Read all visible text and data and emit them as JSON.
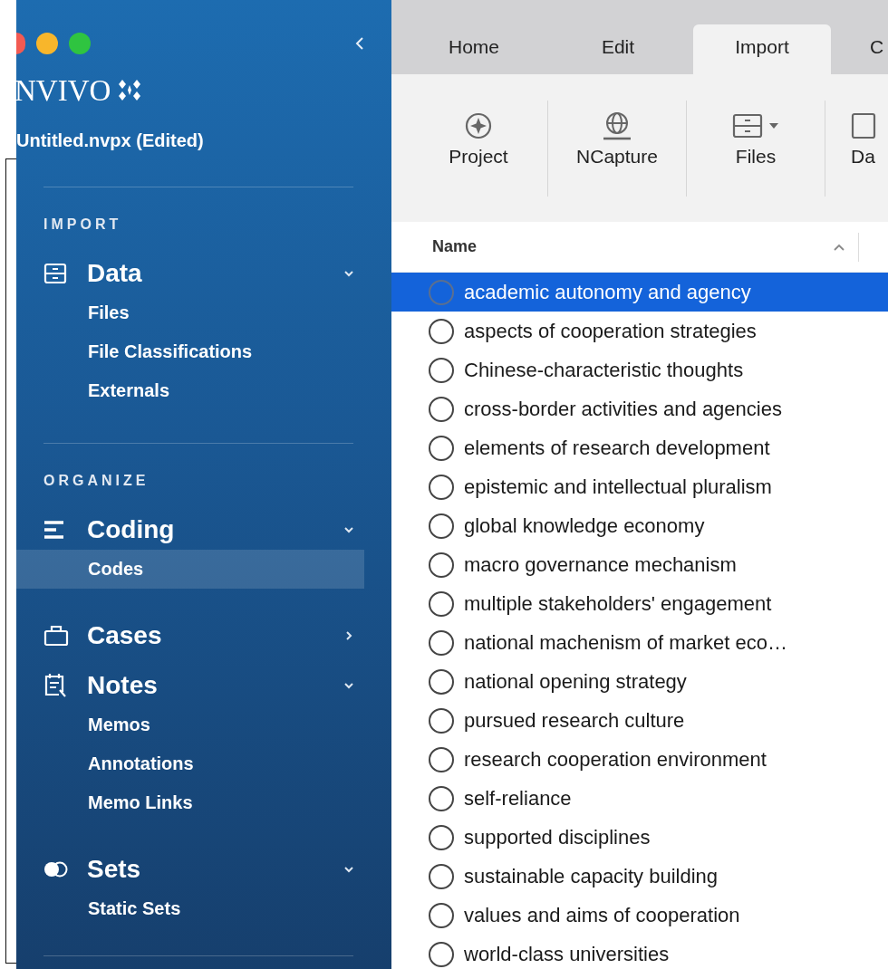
{
  "sidebar": {
    "logo": "NVIVO",
    "file_name": "Untitled.nvpx (Edited)",
    "sections": [
      {
        "heading": "IMPORT",
        "groups": [
          {
            "kind": "data",
            "label": "Data",
            "expanded": true,
            "items": [
              {
                "label": "Files",
                "selected": false
              },
              {
                "label": "File Classifications",
                "selected": false
              },
              {
                "label": "Externals",
                "selected": false
              }
            ]
          }
        ]
      },
      {
        "heading": "ORGANIZE",
        "groups": [
          {
            "kind": "coding",
            "label": "Coding",
            "expanded": true,
            "items": [
              {
                "label": "Codes",
                "selected": true
              }
            ]
          },
          {
            "kind": "cases",
            "label": "Cases",
            "expanded": false
          },
          {
            "kind": "notes",
            "label": "Notes",
            "expanded": true,
            "items": [
              {
                "label": "Memos",
                "selected": false
              },
              {
                "label": "Annotations",
                "selected": false
              },
              {
                "label": "Memo Links",
                "selected": false
              }
            ]
          },
          {
            "kind": "sets",
            "label": "Sets",
            "expanded": true,
            "items": [
              {
                "label": "Static Sets",
                "selected": false
              }
            ]
          }
        ]
      }
    ]
  },
  "tabs": [
    {
      "label": "Home",
      "selected": false
    },
    {
      "label": "Edit",
      "selected": false
    },
    {
      "label": "Import",
      "selected": true
    },
    {
      "label": "C",
      "selected": false
    }
  ],
  "toolbar": [
    {
      "kind": "project",
      "label": "Project",
      "dropdown": false
    },
    {
      "kind": "ncapture",
      "label": "NCapture",
      "dropdown": false
    },
    {
      "kind": "files",
      "label": "Files",
      "dropdown": true
    },
    {
      "kind": "data",
      "label": "Da",
      "dropdown": false
    }
  ],
  "table": {
    "columns": [
      {
        "label": "Name",
        "sorted": true
      }
    ],
    "rows": [
      {
        "label": "academic autonomy and agency",
        "selected": true
      },
      {
        "label": "aspects of cooperation strategies",
        "selected": false
      },
      {
        "label": "Chinese-characteristic thoughts",
        "selected": false
      },
      {
        "label": "cross-border activities and agencies",
        "selected": false
      },
      {
        "label": "elements of research development",
        "selected": false
      },
      {
        "label": "epistemic and intellectual pluralism",
        "selected": false
      },
      {
        "label": "global knowledge economy",
        "selected": false
      },
      {
        "label": "macro governance mechanism",
        "selected": false
      },
      {
        "label": "multiple stakeholders' engagement",
        "selected": false
      },
      {
        "label": "national machenism of market eco…",
        "selected": false
      },
      {
        "label": "national opening strategy",
        "selected": false
      },
      {
        "label": "pursued research culture",
        "selected": false
      },
      {
        "label": "research cooperation environment",
        "selected": false
      },
      {
        "label": "self-reliance",
        "selected": false
      },
      {
        "label": "supported disciplines",
        "selected": false
      },
      {
        "label": "sustainable capacity building",
        "selected": false
      },
      {
        "label": "values and aims of cooperation",
        "selected": false
      },
      {
        "label": "world-class universities",
        "selected": false
      }
    ]
  }
}
